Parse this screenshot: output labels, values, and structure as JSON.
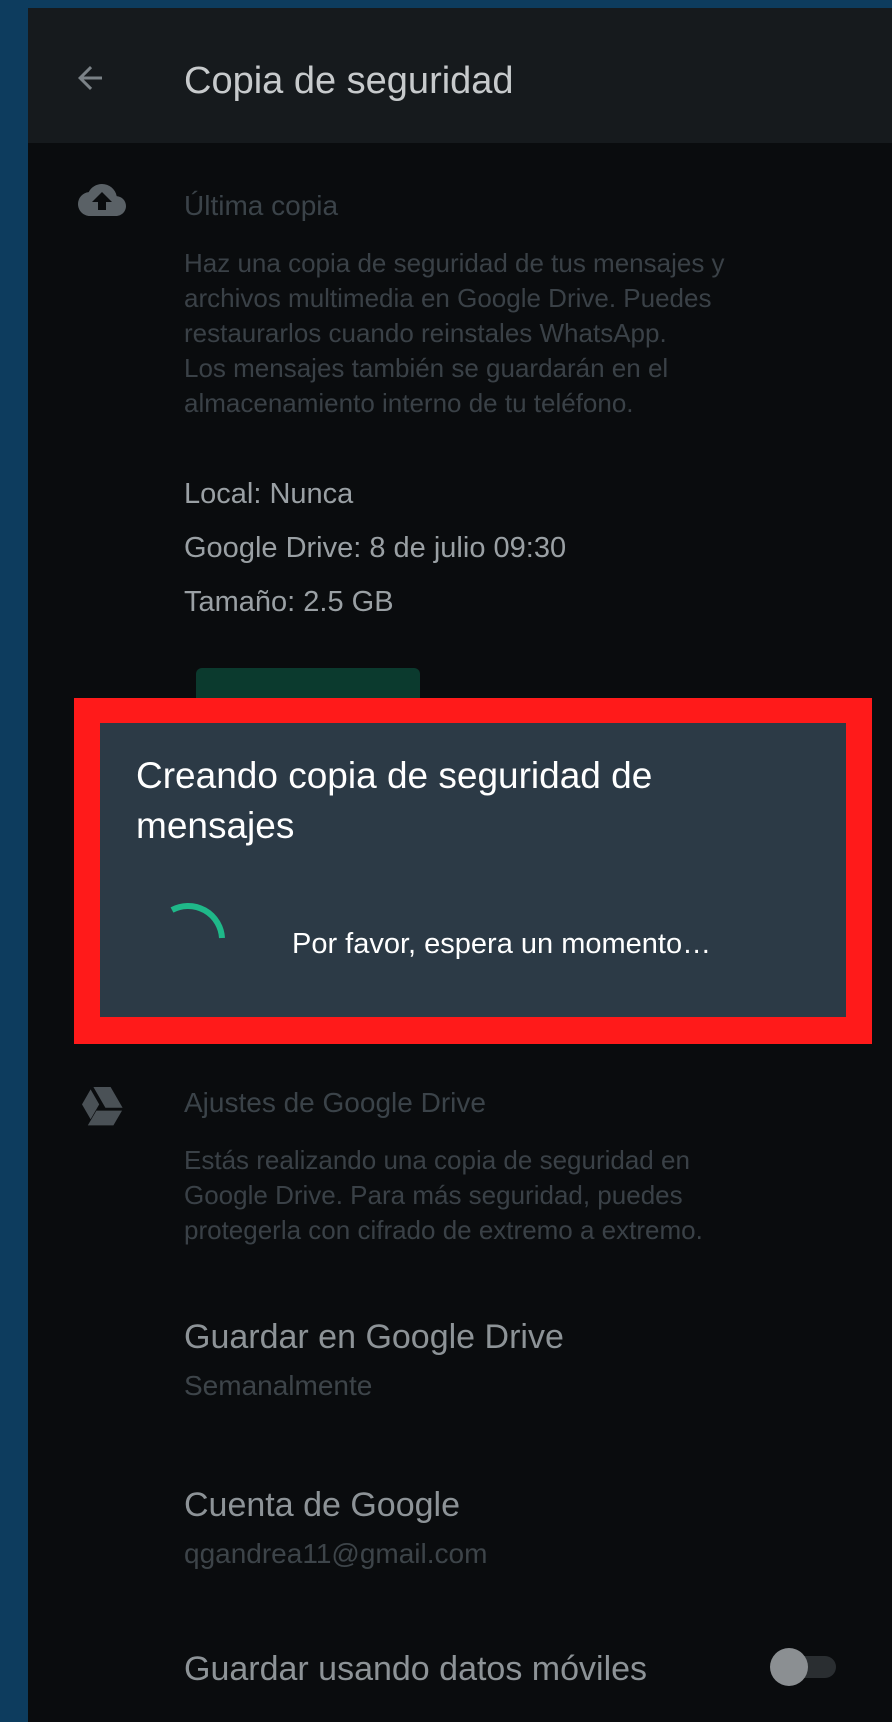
{
  "appbar": {
    "title": "Copia de seguridad",
    "back_icon": "arrow-left-icon"
  },
  "last_backup": {
    "icon": "cloud-upload-icon",
    "title": "Última copia",
    "description_lines": [
      "Haz una copia de seguridad de tus mensajes y",
      "archivos multimedia en Google Drive. Puedes",
      "restaurarlos cuando reinstales WhatsApp.",
      "Los mensajes también se guardarán en el",
      "almacenamiento interno de tu teléfono."
    ],
    "local": "Local: Nunca",
    "google_drive": "Google Drive: 8 de julio 09:30",
    "size": "Tamaño: 2.5 GB"
  },
  "dialog": {
    "title": "Creando copia de seguridad de mensajes",
    "message": "Por favor, espera un momento…",
    "spinner_color": "#1fb889",
    "highlight_color": "#ff1a1a"
  },
  "drive_settings": {
    "icon": "google-drive-icon",
    "title": "Ajustes de Google Drive",
    "description_lines": [
      "Estás realizando una copia de seguridad en",
      "Google Drive. Para más seguridad, puedes",
      "protegerla con cifrado de extremo a extremo."
    ]
  },
  "save_to_drive": {
    "title": "Guardar en Google Drive",
    "value": "Semanalmente"
  },
  "google_account": {
    "title": "Cuenta de Google",
    "value": "qgandrea11@gmail.com"
  },
  "mobile_data": {
    "title": "Guardar usando datos móviles",
    "enabled": false
  }
}
